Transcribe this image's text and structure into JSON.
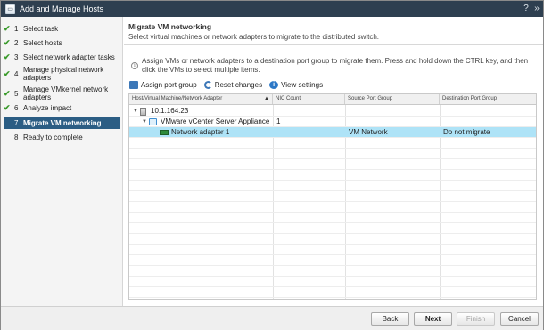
{
  "window": {
    "title": "Add and Manage Hosts"
  },
  "steps": [
    {
      "num": "1",
      "label": "Select task",
      "done": "✔"
    },
    {
      "num": "2",
      "label": "Select hosts",
      "done": "✔"
    },
    {
      "num": "3",
      "label": "Select network adapter tasks",
      "done": "✔"
    },
    {
      "num": "4",
      "label": "Manage physical network adapters",
      "done": "✔"
    },
    {
      "num": "5",
      "label": "Manage VMkernel network adapters",
      "done": "✔"
    },
    {
      "num": "6",
      "label": "Analyze impact",
      "done": "✔"
    },
    {
      "num": "7",
      "label": "Migrate VM networking",
      "done": ""
    },
    {
      "num": "8",
      "label": "Ready to complete",
      "done": ""
    }
  ],
  "content": {
    "title": "Migrate VM networking",
    "subtitle": "Select virtual machines or network adapters to migrate to the distributed switch.",
    "info": "Assign VMs or network adapters to a destination port group to migrate them. Press and hold down the CTRL key, and then click the VMs to select multiple items."
  },
  "toolbar": {
    "assign": "Assign port group",
    "reset": "Reset changes",
    "view": "View settings"
  },
  "grid": {
    "columns": [
      "Host/Virtual Machine/Network Adapter",
      "NIC Count",
      "Source Port Group",
      "Destination Port Group"
    ],
    "sort_icon": "▲",
    "rows": [
      {
        "name": "10.1.164.23",
        "nic": "",
        "source": "",
        "dest": ""
      },
      {
        "name": "VMware vCenter Server Appliance",
        "nic": "1",
        "source": "",
        "dest": ""
      },
      {
        "name": "Network adapter 1",
        "nic": "",
        "source": "VM Network",
        "dest": "Do not migrate"
      }
    ]
  },
  "buttons": {
    "back": "Back",
    "next": "Next",
    "finish": "Finish",
    "cancel": "Cancel"
  }
}
